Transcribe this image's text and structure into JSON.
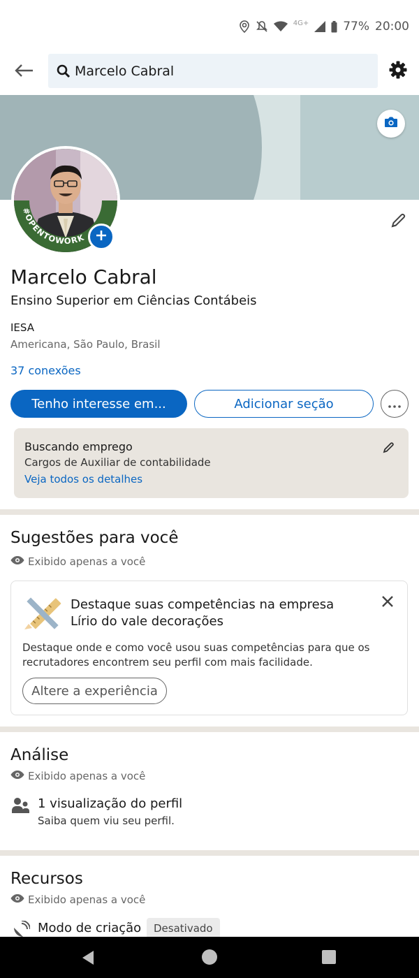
{
  "status": {
    "battery": "77%",
    "time": "20:00",
    "network": "4G+"
  },
  "topbar": {
    "search_value": "Marcelo Cabral"
  },
  "profile": {
    "badge_text": "#OPENTOWORK",
    "name": "Marcelo Cabral",
    "headline": "Ensino Superior em Ciências Contábeis",
    "company": "IESA",
    "location": "Americana, São Paulo, Brasil",
    "connections": "37 conexões"
  },
  "actions": {
    "primary": "Tenho interesse em...",
    "secondary": "Adicionar seção"
  },
  "open_to_work": {
    "title": "Buscando emprego",
    "roles": "Cargos de Auxiliar de contabilidade",
    "link": "Veja todos os detalhes"
  },
  "suggestions": {
    "title": "Sugestões para você",
    "private": "Exibido apenas a você",
    "card_heading_1": "Destaque suas competências na empresa",
    "card_heading_2": "Lírio do vale decorações",
    "card_body": "Destaque onde e como você usou suas competências para que os recrutadores encontrem seu perfil com mais facilidade.",
    "card_button": "Altere a experiência"
  },
  "analytics": {
    "title": "Análise",
    "private": "Exibido apenas a você",
    "views_title": "1 visualização do perfil",
    "views_sub": "Saiba quem viu seu perfil."
  },
  "resources": {
    "title": "Recursos",
    "private": "Exibido apenas a você",
    "creator_title": "Modo de criação",
    "creator_status": "Desativado"
  },
  "colors": {
    "accent": "#0a66c2",
    "open_to_work_green": "#3a6b34",
    "card_bg": "#e9e5df"
  }
}
